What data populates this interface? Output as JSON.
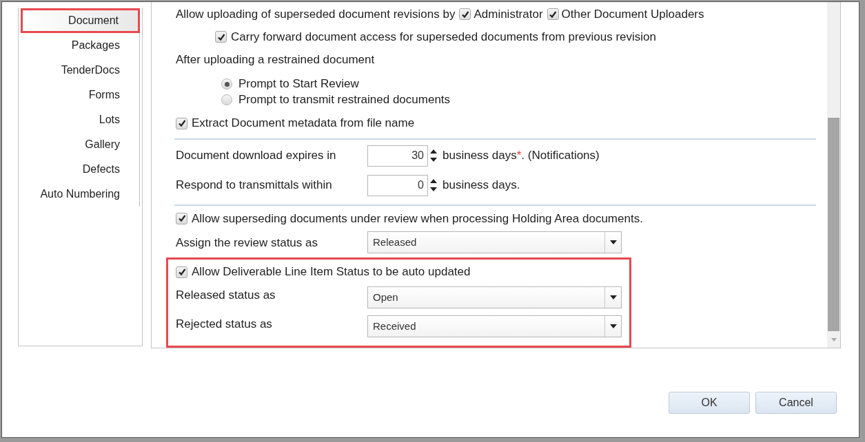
{
  "sidebar": {
    "items": [
      {
        "label": "Document",
        "selected": true,
        "highlighted": true
      },
      {
        "label": "Packages",
        "selected": false,
        "highlighted": false
      },
      {
        "label": "TenderDocs",
        "selected": false,
        "highlighted": false
      },
      {
        "label": "Forms",
        "selected": false,
        "highlighted": false
      },
      {
        "label": "Lots",
        "selected": false,
        "highlighted": false
      },
      {
        "label": "Gallery",
        "selected": false,
        "highlighted": false
      },
      {
        "label": "Defects",
        "selected": false,
        "highlighted": false
      },
      {
        "label": "Auto Numbering",
        "selected": false,
        "highlighted": false
      }
    ]
  },
  "superseded": {
    "label": "Allow uploading of superseded document revisions by",
    "options": [
      {
        "label": "Administrator",
        "checked": true
      },
      {
        "label": "Other Document Uploaders",
        "checked": true
      }
    ]
  },
  "carry_forward": {
    "label": "Carry forward document access for superseded documents from previous revision",
    "checked": true
  },
  "restrained": {
    "label": "After uploading a restrained document",
    "options": [
      {
        "label": "Prompt to Start Review",
        "selected": true
      },
      {
        "label": "Prompt to transmit restrained documents",
        "selected": false
      }
    ]
  },
  "extract_metadata": {
    "label": "Extract Document metadata from file name",
    "checked": true
  },
  "download_expiry": {
    "label": "Document download expires in",
    "value": "30",
    "suffix": "business days",
    "required_mark": "*",
    "note": ". (Notifications)"
  },
  "respond": {
    "label": "Respond to transmittals within",
    "value": "0",
    "suffix": "business days."
  },
  "allow_superseding_review": {
    "label": "Allow superseding documents under review when processing Holding Area documents.",
    "checked": true
  },
  "assign_review_status": {
    "label": "Assign the review status as",
    "value": "Released"
  },
  "deliverable": {
    "highlighted": true,
    "label": "Allow Deliverable Line Item Status to be auto updated",
    "checked": true,
    "fields": [
      {
        "label": "Released status as",
        "value": "Open"
      },
      {
        "label": "Rejected status as",
        "value": "Received"
      }
    ]
  },
  "buttons": [
    "OK",
    "Cancel"
  ]
}
